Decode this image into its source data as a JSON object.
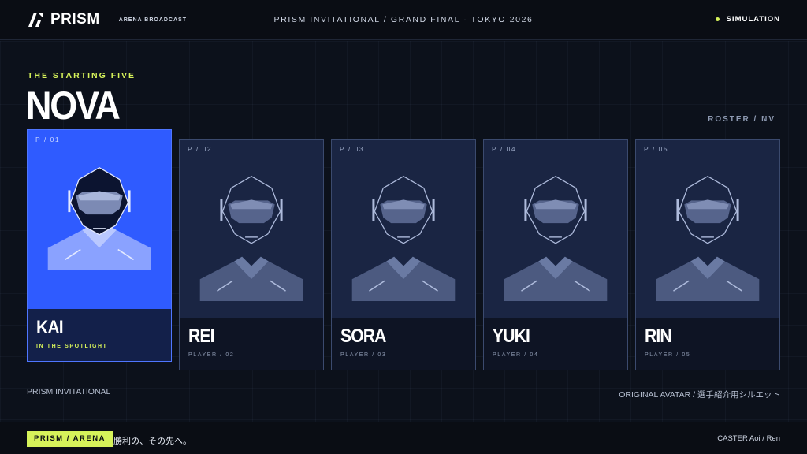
{
  "header": {
    "brand": "PRISM",
    "brand_sub": "ARENA BROADCAST",
    "title": "PRISM INVITATIONAL / GRAND FINAL · TOKYO 2026",
    "status": "SIMULATION",
    "status_color": "#d6f25a"
  },
  "main": {
    "kicker": "THE STARTING FIVE",
    "team": "NOVA",
    "roster_label": "ROSTER / NV",
    "players": [
      {
        "num": "P / 01",
        "name": "KAI",
        "sub": "IN THE SPOTLIGHT",
        "spotlight": true,
        "icon": "player-avatar-icon"
      },
      {
        "num": "P / 02",
        "name": "REI",
        "sub": "PLAYER / 02",
        "spotlight": false,
        "icon": "player-avatar-icon"
      },
      {
        "num": "P / 03",
        "name": "SORA",
        "sub": "PLAYER / 03",
        "spotlight": false,
        "icon": "player-avatar-icon"
      },
      {
        "num": "P / 04",
        "name": "YUKI",
        "sub": "PLAYER / 04",
        "spotlight": false,
        "icon": "player-avatar-icon"
      },
      {
        "num": "P / 05",
        "name": "RIN",
        "sub": "PLAYER / 05",
        "spotlight": false,
        "icon": "player-avatar-icon"
      }
    ],
    "footnote_left": "PRISM INVITATIONAL",
    "footnote_right": "ORIGINAL AVATAR / 選手紹介用シルエット"
  },
  "footer": {
    "badge": "PRISM / ARENA",
    "tagline": "勝利の、その先へ。",
    "caster": "CASTER Aoi / Ren"
  },
  "colors": {
    "accent": "#d6f25a",
    "spotlight": "#2f5bff",
    "card": "#1a2543",
    "background": "#0b0f18"
  }
}
